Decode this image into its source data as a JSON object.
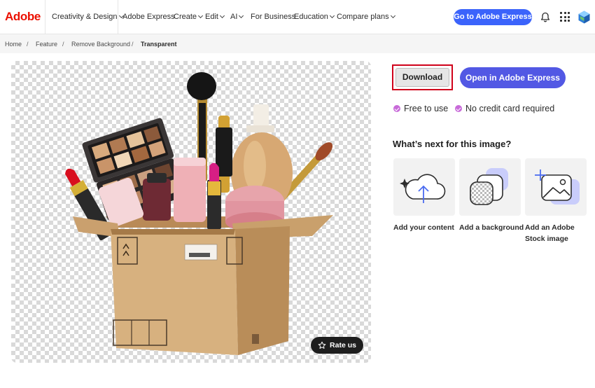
{
  "header": {
    "logo": "Adobe",
    "nav": [
      {
        "label": "Creativity & Design",
        "has_menu": true
      },
      {
        "label": "Adobe Express",
        "has_menu": false
      },
      {
        "label": "Create",
        "has_menu": true
      },
      {
        "label": "Edit",
        "has_menu": true
      },
      {
        "label": "AI",
        "has_menu": true
      },
      {
        "label": "For Business",
        "has_menu": false
      },
      {
        "label": "Education",
        "has_menu": true
      },
      {
        "label": "Compare plans",
        "has_menu": true
      }
    ],
    "cta_label": "Go to Adobe Express",
    "icons": [
      "bell-icon",
      "app-grid-icon",
      "profile-avatar"
    ]
  },
  "breadcrumb": {
    "items": [
      "Home",
      "Feature",
      "Remove Background",
      "Transparent"
    ],
    "separator": "/"
  },
  "preview": {
    "rate_label": "Rate us",
    "rate_icon": "star-icon"
  },
  "actions": {
    "download_label": "Download",
    "open_label": "Open in Adobe Express"
  },
  "perks": [
    "Free to use",
    "No credit card required"
  ],
  "next": {
    "title": "What’s next for this image?",
    "cards": [
      {
        "label": "Add your content",
        "icon": "cloud-upload-icon"
      },
      {
        "label": "Add a background",
        "icon": "background-layers-icon"
      },
      {
        "label": "Add an Adobe Stock image",
        "icon": "add-image-icon"
      }
    ]
  },
  "colors": {
    "brand": "#eb1000",
    "cta_blue": "#3b63fb",
    "open_button": "#5258e4",
    "perk_check": "#c86ad9",
    "highlight_border": "#d0021b"
  }
}
